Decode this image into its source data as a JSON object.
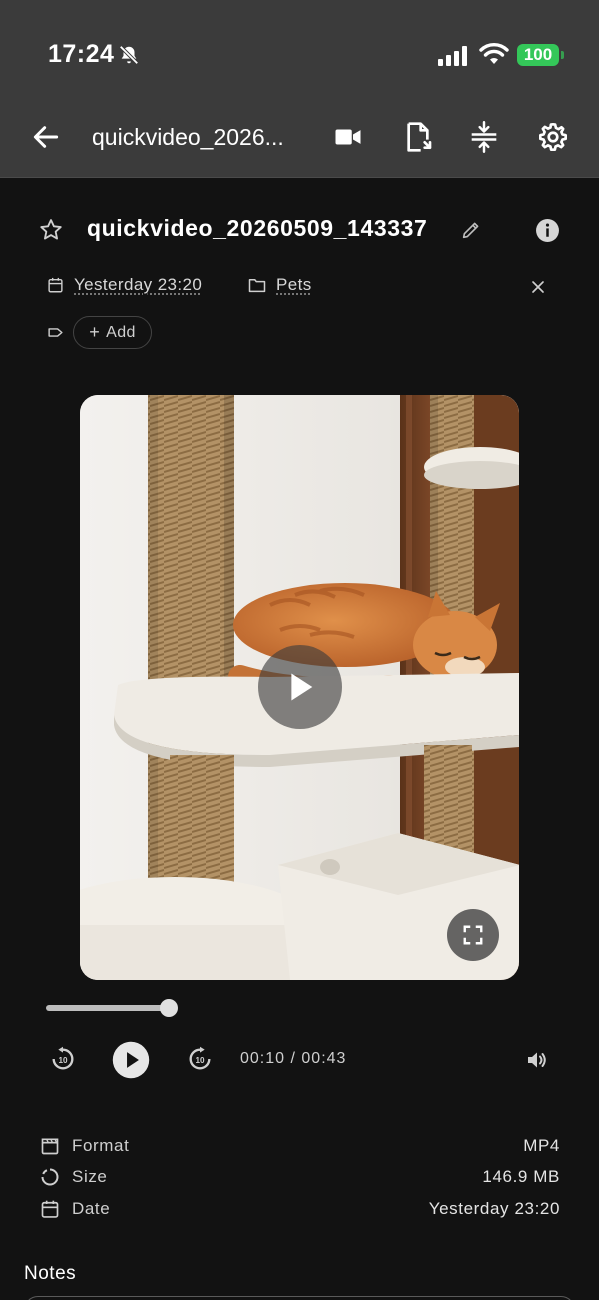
{
  "status_bar": {
    "time": "17:24",
    "battery": "100"
  },
  "app_bar": {
    "title": "quickvideo_2026...",
    "icons": [
      "back-arrow-icon",
      "video-camera-icon",
      "file-export-icon",
      "compress-icon",
      "gear-icon"
    ]
  },
  "header": {
    "title": "quickvideo_20260509_143337",
    "date": "Yesterday 23:20",
    "folder": "Pets",
    "add_tag_label": "Add"
  },
  "player": {
    "current_time": "00:10",
    "separator": "/",
    "duration": "00:43",
    "progress_fraction": 0.23
  },
  "details": [
    {
      "icon": "clapperboard-icon",
      "label": "Format",
      "value": "MP4"
    },
    {
      "icon": "size-ring-icon",
      "label": "Size",
      "value": "146.9 MB"
    },
    {
      "icon": "calendar-icon",
      "label": "Date",
      "value": "Yesterday 23:20"
    }
  ],
  "notes": {
    "heading": "Notes"
  },
  "colors": {
    "app_bar_bg": "#3b3b3b",
    "page_bg": "#121212",
    "battery_green": "#34c759"
  }
}
